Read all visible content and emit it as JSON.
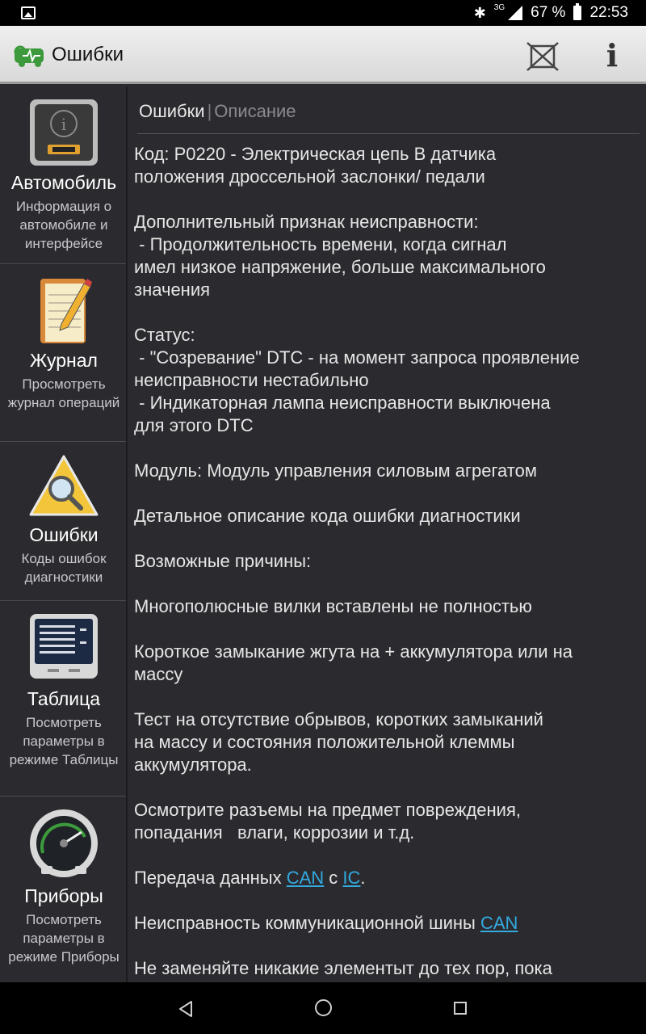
{
  "status_bar": {
    "network": "3G",
    "battery": "67 %",
    "time": "22:53"
  },
  "app_bar": {
    "title": "Ошибки",
    "info_label": "i"
  },
  "sidebar": {
    "items": [
      {
        "label": "Автомобиль",
        "sub": "Информация о автомобиле и интерфейсе",
        "icon": "car-info-icon"
      },
      {
        "label": "Журнал",
        "sub": "Просмотреть журнал операций",
        "icon": "notepad-icon"
      },
      {
        "label": "Ошибки",
        "sub": "Коды ошибок диагностики",
        "icon": "warning-magnifier-icon"
      },
      {
        "label": "Таблица",
        "sub": "Посмотреть параметры в режиме Таблицы",
        "icon": "table-monitor-icon"
      },
      {
        "label": "Приборы",
        "sub": "Посмотреть параметры в режиме Приборы",
        "icon": "gauge-icon"
      }
    ]
  },
  "content": {
    "tabs": {
      "active": "Ошибки",
      "separator": "|",
      "inactive": "Описание"
    },
    "paragraphs": {
      "p1": "Код: P0220 - Электрическая цепь B датчика\nположения дроссельной заслонки/ педали",
      "p2": "Дополнительный признак неисправности:\n - Продолжительность времени, когда сигнал\nимел низкое напряжение, больше максимального\nзначения",
      "p3": "Статус:\n - \"Созревание\" DTC - на момент запроса проявление\nнеисправности нестабильно\n - Индикаторная лампа неисправности выключена\nдля этого DTC",
      "p4": "Модуль: Модуль управления силовым агрегатом",
      "p5": "Детальное описание кода ошибки диагностики",
      "p6": "Возможные причины:",
      "p7": "Многополюсные вилки вставлены не полностью",
      "p8": "Короткое замыкание жгута на + аккумулятора или на\nмассу",
      "p9": "Тест на отсутствие обрывов, коротких замыканий\nна массу и состояния положительной клеммы\nаккумулятора.",
      "p10": "Осмотрите разъемы на предмет повреждения,\nпопадания   влаги, коррозии и т.д.",
      "p11_prefix": "Передача данных ",
      "p11_link1": "CAN",
      "p11_mid": " с ",
      "p11_link2": "IC",
      "p11_suffix": ".",
      "p12_prefix": "Неисправность коммуникационной шины ",
      "p12_link": "CAN",
      "p13": "Не заменяйте никакие элементыт до тех пор, пока"
    }
  }
}
